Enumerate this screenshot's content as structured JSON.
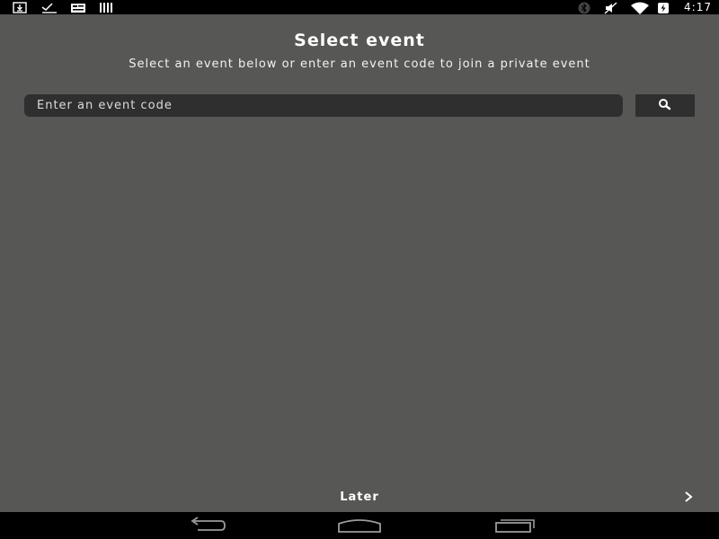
{
  "status_bar": {
    "time": "4:17",
    "left_icons": [
      "download-icon",
      "check-icon",
      "message-icon",
      "storage-icon"
    ],
    "right_icons": [
      "bluetooth-icon",
      "mute-icon",
      "wifi-icon",
      "battery-icon"
    ]
  },
  "page": {
    "title": "Select event",
    "subtitle": "Select an event below or enter an event code to join a private event"
  },
  "search": {
    "value": "",
    "placeholder": "Enter an event code",
    "button_icon": "search-icon"
  },
  "footer": {
    "later_label": "Later",
    "next_icon": "chevron-right-icon"
  },
  "nav_bar": {
    "buttons": [
      "back-icon",
      "home-icon",
      "recent-apps-icon"
    ]
  },
  "colors": {
    "background": "#575755",
    "field": "#2f2f2f",
    "bar": "#000000",
    "text": "#ffffff"
  }
}
